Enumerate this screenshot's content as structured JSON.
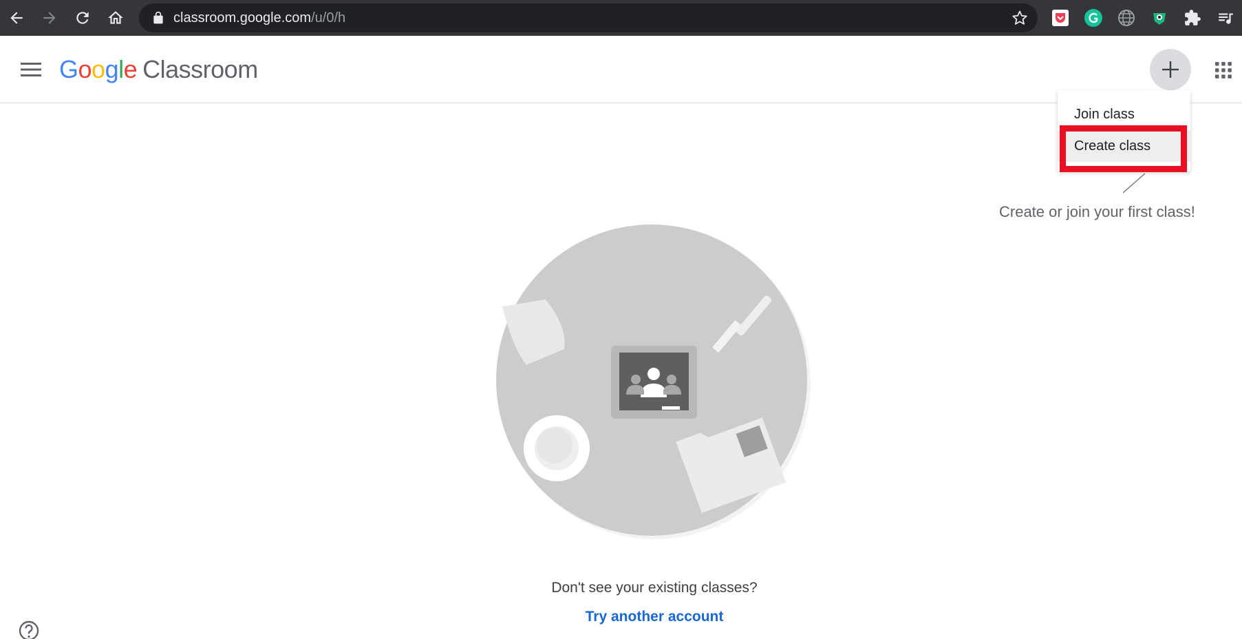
{
  "browser": {
    "url_host": "classroom.google.com",
    "url_path": "/u/0/h",
    "icons": [
      "back-icon",
      "forward-icon",
      "reload-icon",
      "home-icon",
      "lock-icon",
      "star-icon",
      "extensions-icon",
      "reading-list-icon"
    ]
  },
  "header": {
    "logo_letters": [
      "G",
      "o",
      "o",
      "g",
      "l",
      "e"
    ],
    "product_name": "Classroom"
  },
  "menu": {
    "items": [
      {
        "label": "Join class"
      },
      {
        "label": "Create class"
      }
    ],
    "highlight_color": "#e81123"
  },
  "hint": {
    "text": "Create or join your first class!"
  },
  "empty_state": {
    "question": "Don't see your existing classes?",
    "link": "Try another account"
  },
  "colors": {
    "chrome_bg": "#35363a",
    "omnibox_bg": "#202124",
    "link": "#1967d2",
    "google_blue": "#4285f4",
    "google_red": "#ea4335",
    "google_yellow": "#fbbc05",
    "google_green": "#34a853"
  }
}
